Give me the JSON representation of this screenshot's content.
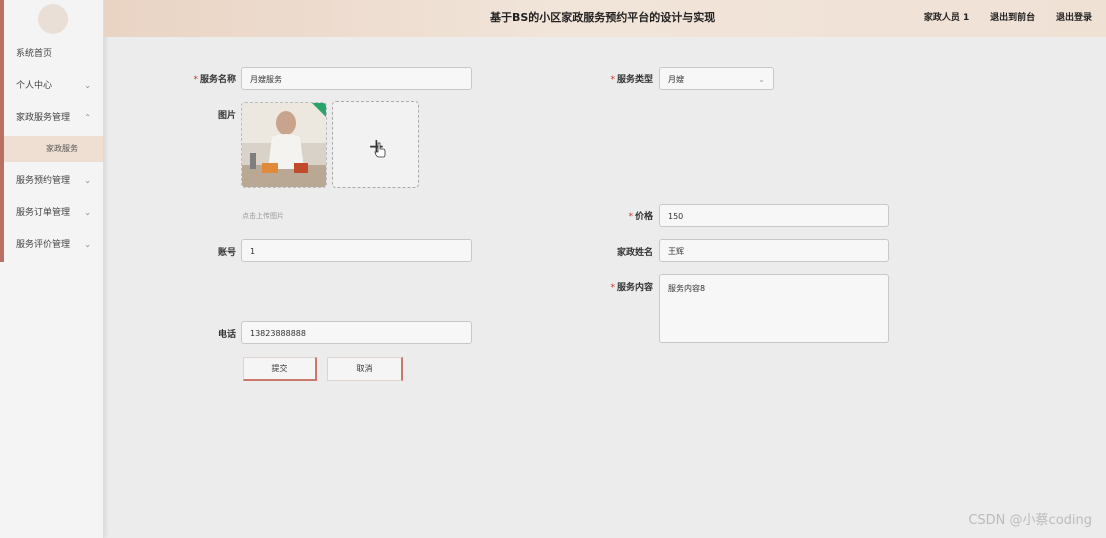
{
  "sidebar": {
    "items": [
      {
        "label": "系统首页",
        "chevron": ""
      },
      {
        "label": "个人中心",
        "chevron": "⌄"
      },
      {
        "label": "家政服务管理",
        "chevron": "⌃"
      },
      {
        "label": "家政服务",
        "chevron": ""
      },
      {
        "label": "服务预约管理",
        "chevron": "⌄"
      },
      {
        "label": "服务订单管理",
        "chevron": "⌄"
      },
      {
        "label": "服务评价管理",
        "chevron": "⌄"
      }
    ]
  },
  "header": {
    "title": "基于BS的小区家政服务预约平台的设计与实现",
    "user": "家政人员 1",
    "front": "退出到前台",
    "logout": "退出登录"
  },
  "form": {
    "service_name": {
      "label": "服务名称",
      "value": "月嫂服务"
    },
    "service_type": {
      "label": "服务类型",
      "value": "月嫂"
    },
    "image": {
      "label": "图片",
      "hint": "点击上传图片",
      "plus": "+"
    },
    "price": {
      "label": "价格",
      "value": "150"
    },
    "account": {
      "label": "账号",
      "value": "1"
    },
    "worker_name": {
      "label": "家政姓名",
      "value": "王辉"
    },
    "service_content": {
      "label": "服务内容",
      "value": "服务内容8"
    },
    "phone": {
      "label": "电话",
      "value": "13823888888"
    },
    "submit": "提交",
    "cancel": "取消"
  },
  "watermark": "CSDN @小蔡coding"
}
